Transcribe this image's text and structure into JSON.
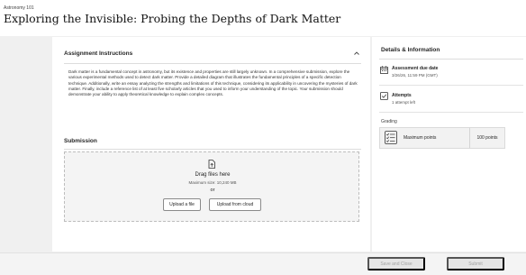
{
  "header": {
    "course": "Astronomy 101",
    "title": "Exploring the Invisible: Probing the Depths of Dark Matter"
  },
  "instructions": {
    "heading": "Assignment Instructions",
    "text": "Dark matter is a fundamental concept in astronomy, but its existence and properties are still largely unknown. In a comprehensive submission, explore the various experimental methods used to detect dark matter. Provide a detailed diagram that illustrates the fundamental principles of a specific detection technique. Additionally, write an essay analyzing the strengths and limitations of this technique, considering its applicability in uncovering the mysteries of dark matter. Finally, include a reference list of at least five scholarly articles that you used to inform your understanding of the topic. Your submission should demonstrate your ability to apply theoretical knowledge to explain complex concepts."
  },
  "submission": {
    "heading": "Submission",
    "drag_text": "Drag files here",
    "max_size": "Maximum size: 10,240 MB",
    "or_text": "or",
    "upload_file": "Upload a file",
    "upload_cloud": "Upload from cloud"
  },
  "details": {
    "heading": "Details & Information",
    "due_label": "Assessment due date",
    "due_value": "3/26/26, 11:59 PM (GMT)",
    "attempts_label": "Attempts",
    "attempts_value": "1 attempt left",
    "grading_label": "Grading",
    "max_points_label": "Maximum points",
    "max_points_value": "100 points"
  },
  "footer": {
    "save_close": "Save and Close",
    "submit": "Submit"
  },
  "icons": {
    "collapse": "chevron-up-icon",
    "file": "file-upload-icon",
    "due": "calendar-icon",
    "attempts": "checkbox-icon",
    "grading": "checklist-icon"
  }
}
